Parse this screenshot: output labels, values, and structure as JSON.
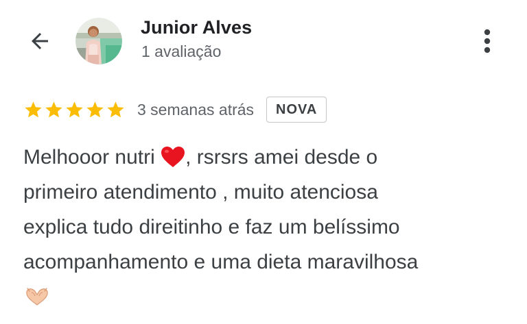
{
  "header": {
    "reviewer_name": "Junior Alves",
    "review_count": "1 avaliação",
    "back_icon": "arrow-left-icon",
    "more_icon": "more-vertical-icon"
  },
  "rating": {
    "stars": 5,
    "max_stars": 5,
    "star_color": "#fbbc04",
    "date": "3 semanas atrás",
    "badge": "NOVA"
  },
  "review": {
    "line1_a": "Melhooor nutri ",
    "line1_icon": "red-heart-icon",
    "line1_b": ", rsrsrs amei desde o",
    "line2": "primeiro atendimento , muito atenciosa",
    "line3": "explica tudo direitinho e faz um belíssimo",
    "line4": "acompanhamento e uma dieta maravilhosa",
    "line5_icon": "heart-hands-icon"
  }
}
